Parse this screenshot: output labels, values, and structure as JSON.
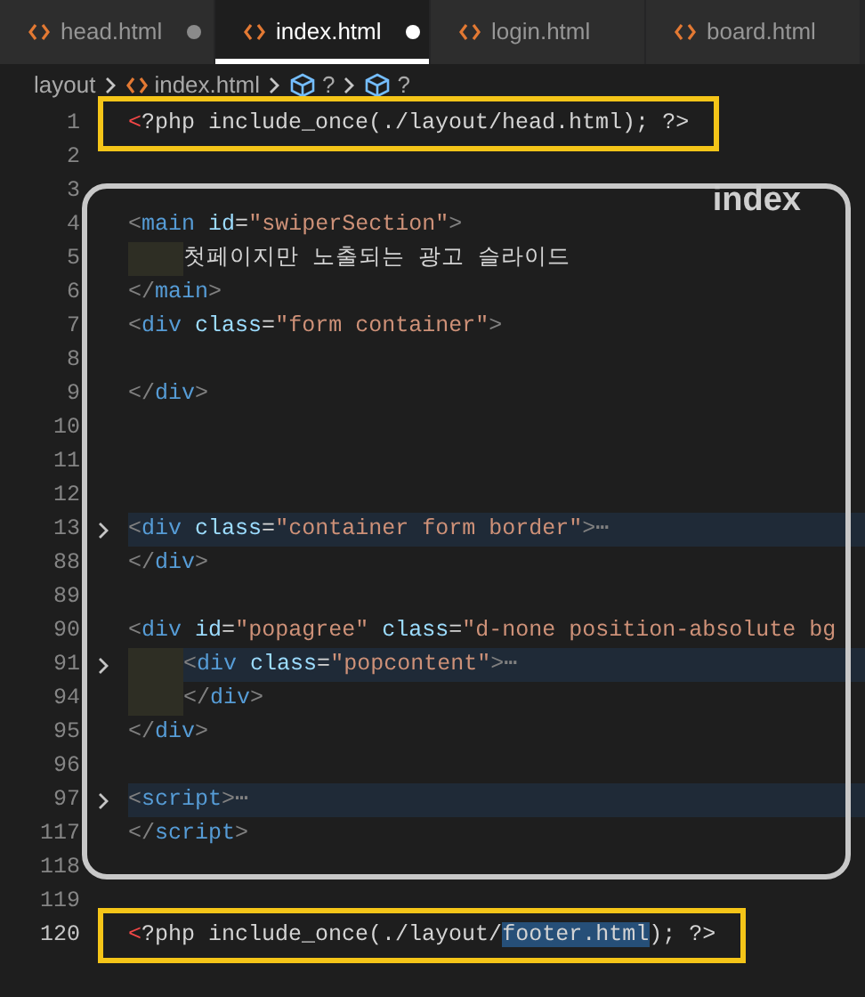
{
  "tabs": [
    {
      "label": "head.html",
      "selected": false,
      "dirty": true
    },
    {
      "label": "index.html",
      "selected": true,
      "dirty": true
    },
    {
      "label": "login.html",
      "selected": false,
      "dirty": false
    },
    {
      "label": "board.html",
      "selected": false,
      "dirty": false
    }
  ],
  "breadcrumb": [
    {
      "kind": "folder",
      "text": "layout"
    },
    {
      "kind": "file",
      "text": "index.html"
    },
    {
      "kind": "symbol",
      "text": "?"
    },
    {
      "kind": "symbol",
      "text": "?"
    }
  ],
  "sections": [
    {
      "kind": "boxed",
      "lines": [
        {
          "num": "1",
          "tokens": [
            {
              "kind": "php",
              "text": "<"
            },
            {
              "kind": "text",
              "text": "?php include_once(./layout/head.html); ?>"
            }
          ]
        }
      ]
    },
    {
      "kind": "plain",
      "lines": [
        {
          "num": "2"
        }
      ]
    },
    {
      "kind": "framed",
      "label": "index",
      "lines": [
        {
          "num": "3"
        },
        {
          "num": "4",
          "tokens": [
            {
              "kind": "punc",
              "text": "<"
            },
            {
              "kind": "tag",
              "text": "main"
            },
            {
              "kind": "attr",
              "text": " id"
            },
            {
              "kind": "text",
              "text": "="
            },
            {
              "kind": "str",
              "text": "\"swiperSection\""
            },
            {
              "kind": "punc",
              "text": ">"
            }
          ]
        },
        {
          "num": "5",
          "indented": true,
          "tokens": [
            {
              "kind": "text",
              "text": "첫페이지만 노출되는 광고 슬라이드"
            }
          ]
        },
        {
          "num": "6",
          "tokens": [
            {
              "kind": "punc",
              "text": "</"
            },
            {
              "kind": "tag",
              "text": "main"
            },
            {
              "kind": "punc",
              "text": ">"
            }
          ]
        },
        {
          "num": "7",
          "tokens": [
            {
              "kind": "punc",
              "text": "<"
            },
            {
              "kind": "tag",
              "text": "div"
            },
            {
              "kind": "attr",
              "text": " class"
            },
            {
              "kind": "text",
              "text": "="
            },
            {
              "kind": "str",
              "text": "\"form container\""
            },
            {
              "kind": "punc",
              "text": ">"
            }
          ]
        },
        {
          "num": "8"
        },
        {
          "num": "9",
          "tokens": [
            {
              "kind": "punc",
              "text": "</"
            },
            {
              "kind": "tag",
              "text": "div"
            },
            {
              "kind": "punc",
              "text": ">"
            }
          ]
        },
        {
          "num": "10"
        },
        {
          "num": "11"
        },
        {
          "num": "12"
        },
        {
          "num": "13",
          "folded": true,
          "tokens": [
            {
              "kind": "punc",
              "text": "<"
            },
            {
              "kind": "tag",
              "text": "div"
            },
            {
              "kind": "attr",
              "text": " class"
            },
            {
              "kind": "text",
              "text": "="
            },
            {
              "kind": "str",
              "text": "\"container form border\""
            },
            {
              "kind": "punc",
              "text": ">"
            },
            {
              "kind": "punc",
              "text": "⋯"
            }
          ]
        },
        {
          "num": "88",
          "tokens": [
            {
              "kind": "punc",
              "text": "</"
            },
            {
              "kind": "tag",
              "text": "div"
            },
            {
              "kind": "punc",
              "text": ">"
            }
          ]
        },
        {
          "num": "89"
        },
        {
          "num": "90",
          "tokens": [
            {
              "kind": "punc",
              "text": "<"
            },
            {
              "kind": "tag",
              "text": "div"
            },
            {
              "kind": "attr",
              "text": " id"
            },
            {
              "kind": "text",
              "text": "="
            },
            {
              "kind": "str",
              "text": "\"popagree\""
            },
            {
              "kind": "attr",
              "text": " class"
            },
            {
              "kind": "text",
              "text": "="
            },
            {
              "kind": "str",
              "text": "\"d-none position-absolute bg"
            }
          ]
        },
        {
          "num": "91",
          "folded": true,
          "indented": true,
          "tokens": [
            {
              "kind": "punc",
              "text": "<"
            },
            {
              "kind": "tag",
              "text": "div"
            },
            {
              "kind": "attr",
              "text": " class"
            },
            {
              "kind": "text",
              "text": "="
            },
            {
              "kind": "str",
              "text": "\"popcontent\""
            },
            {
              "kind": "punc",
              "text": ">"
            },
            {
              "kind": "punc",
              "text": "⋯"
            }
          ]
        },
        {
          "num": "94",
          "indented": true,
          "tokens": [
            {
              "kind": "punc",
              "text": "</"
            },
            {
              "kind": "tag",
              "text": "div"
            },
            {
              "kind": "punc",
              "text": ">"
            }
          ]
        },
        {
          "num": "95",
          "tokens": [
            {
              "kind": "punc",
              "text": "</"
            },
            {
              "kind": "tag",
              "text": "div"
            },
            {
              "kind": "punc",
              "text": ">"
            }
          ]
        },
        {
          "num": "96"
        },
        {
          "num": "97",
          "folded": true,
          "tokens": [
            {
              "kind": "punc",
              "text": "<"
            },
            {
              "kind": "tag",
              "text": "script"
            },
            {
              "kind": "punc",
              "text": ">"
            },
            {
              "kind": "punc",
              "text": "⋯"
            }
          ]
        },
        {
          "num": "117",
          "tokens": [
            {
              "kind": "punc",
              "text": "</"
            },
            {
              "kind": "tag",
              "text": "script"
            },
            {
              "kind": "punc",
              "text": ">"
            }
          ]
        },
        {
          "num": "118"
        }
      ]
    },
    {
      "kind": "plain",
      "lines": [
        {
          "num": "119"
        }
      ]
    },
    {
      "kind": "boxed",
      "lines": [
        {
          "num": "120",
          "current": true,
          "tokens": [
            {
              "kind": "php",
              "text": "<"
            },
            {
              "kind": "text",
              "text": "?php include_once(./layout/"
            },
            {
              "kind": "selected",
              "text": "footer.html"
            },
            {
              "kind": "text",
              "text": "); ?>"
            }
          ]
        }
      ]
    }
  ]
}
